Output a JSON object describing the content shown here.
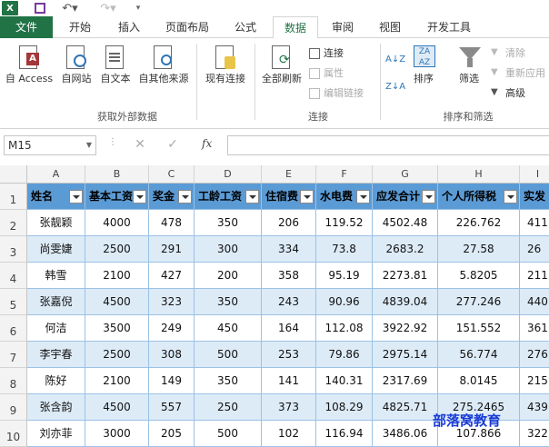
{
  "qat": {
    "logo": "X"
  },
  "tabs": [
    "文件",
    "开始",
    "插入",
    "页面布局",
    "公式",
    "数据",
    "审阅",
    "视图",
    "开发工具"
  ],
  "ribbon": {
    "get_external": {
      "buttons": [
        "自 Access",
        "自网站",
        "自文本",
        "自其他来源"
      ],
      "existing": "现有连接",
      "label": "获取外部数据"
    },
    "connections": {
      "refresh": "全部刷新",
      "items": [
        "连接",
        "属性",
        "编辑链接"
      ],
      "label": "连接"
    },
    "sort_filter": {
      "sort": "排序",
      "filter": "筛选",
      "items": [
        "清除",
        "重新应用",
        "高级"
      ],
      "label": "排序和筛选"
    }
  },
  "formula_bar": {
    "name_box": "M15",
    "fx": "fx",
    "formula": ""
  },
  "columns": [
    "A",
    "B",
    "C",
    "D",
    "E",
    "F",
    "G",
    "H",
    "I"
  ],
  "rows": [
    "1",
    "2",
    "3",
    "4",
    "5",
    "6",
    "7",
    "8",
    "9",
    "10"
  ],
  "table": {
    "headers": [
      "姓名",
      "基本工资",
      "奖金",
      "工龄工资",
      "住宿费",
      "水电费",
      "应发合计",
      "个人所得税",
      "实发"
    ],
    "data": [
      [
        "张靓颖",
        "4000",
        "478",
        "350",
        "206",
        "119.52",
        "4502.48",
        "226.762",
        "411"
      ],
      [
        "尚雯婕",
        "2500",
        "291",
        "300",
        "334",
        "73.8",
        "2683.2",
        "27.58",
        "26"
      ],
      [
        "韩雪",
        "2100",
        "427",
        "200",
        "358",
        "95.19",
        "2273.81",
        "5.8205",
        "211"
      ],
      [
        "张嘉倪",
        "4500",
        "323",
        "350",
        "243",
        "90.96",
        "4839.04",
        "277.246",
        "440"
      ],
      [
        "何洁",
        "3500",
        "249",
        "450",
        "164",
        "112.08",
        "3922.92",
        "151.552",
        "361"
      ],
      [
        "李宇春",
        "2500",
        "308",
        "500",
        "253",
        "79.86",
        "2975.14",
        "56.774",
        "276"
      ],
      [
        "陈好",
        "2100",
        "149",
        "350",
        "141",
        "140.31",
        "2317.69",
        "8.0145",
        "215"
      ],
      [
        "张含韵",
        "4500",
        "557",
        "250",
        "373",
        "108.29",
        "4825.71",
        "275.2465",
        "439"
      ],
      [
        "刘亦菲",
        "3000",
        "205",
        "500",
        "102",
        "116.94",
        "3486.06",
        "107.866",
        "322"
      ]
    ]
  },
  "watermark": "部落窝教育"
}
